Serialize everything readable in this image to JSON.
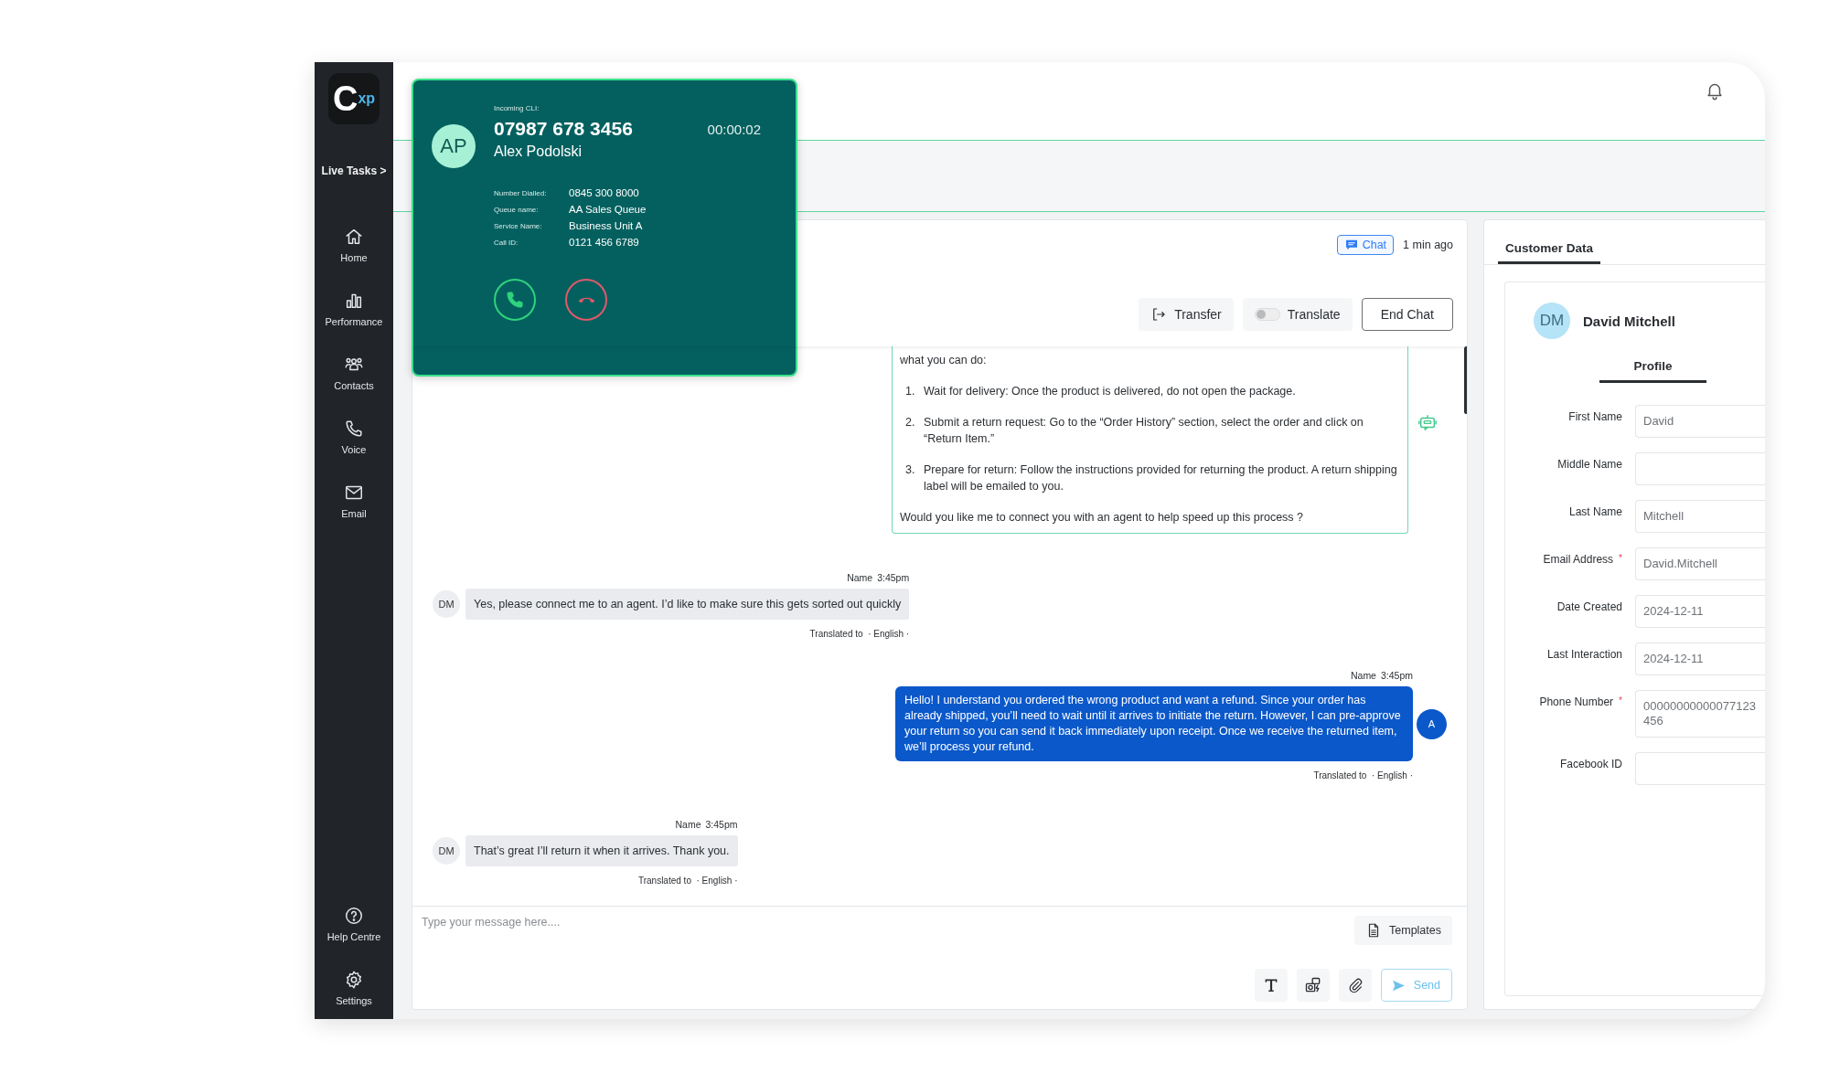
{
  "sidebar": {
    "logo": "C$^{xp}$",
    "live_tasks": "Live Tasks >",
    "items": [
      {
        "label": "Home"
      },
      {
        "label": "Performance"
      },
      {
        "label": "Contacts"
      },
      {
        "label": "Voice"
      },
      {
        "label": "Email"
      }
    ],
    "footer_items": [
      {
        "label": "Help Centre"
      },
      {
        "label": "Settings"
      }
    ]
  },
  "call": {
    "caption": "Incoming CLI:",
    "initials": "AP",
    "number": "07987 678 3456",
    "name": "Alex Podolski",
    "timer": "00:00:02",
    "details": [
      {
        "label": "Number Dialled:",
        "value": "0845 300 8000"
      },
      {
        "label": "Queue name:",
        "value": "AA Sales Queue"
      },
      {
        "label": "Service Name:",
        "value": "Business Unit A"
      },
      {
        "label": "Call ID:",
        "value": "0121 456 6789"
      }
    ]
  },
  "chat": {
    "channel": "Chat",
    "time": "1 min ago",
    "actions": [
      {
        "kind": "transfer",
        "label": "Transfer"
      },
      {
        "kind": "toggle",
        "label": "Translate",
        "on": false
      },
      {
        "kind": "outline",
        "label": "End Chat"
      }
    ],
    "messages": [
      {
        "kind": "bot",
        "intro": "what you can do:",
        "steps": [
          {
            "number": "1.",
            "text": "Wait for delivery: Once the product is delivered, do not open the package."
          },
          {
            "number": "2.",
            "text": "Submit a return request: Go to the “Order History” section, select the order and click on “Return Item.”"
          },
          {
            "number": "3.",
            "text": "Prepare for return: Follow the instructions provided for returning the product. A return shipping label will be emailed to you."
          }
        ],
        "outro": "Would you like me to connect you with an agent to help speed up this process ?"
      },
      {
        "kind": "customer",
        "sender": "Name",
        "time": "3:45pm",
        "initials": "DM",
        "text": "Yes, please connect me to an agent. I’d like to make sure this gets sorted out quickly",
        "translation": "Translated to  · English ·"
      },
      {
        "kind": "agent",
        "sender": "Name",
        "time": "3:45pm",
        "initials": "A",
        "text": "Hello! I understand you ordered the wrong product and want a refund. Since your order has already shipped, you’ll need to wait until it arrives to initiate the return. However, I can pre-approve your return so you can send it back immediately upon receipt. Once we receive the returned item, we’ll process your refund.",
        "translation": "Translated to  · English ·"
      },
      {
        "kind": "customer",
        "sender": "Name",
        "time": "3:45pm",
        "initials": "DM",
        "text": "That’s great I’ll return it when it arrives. Thank you.",
        "translation": "Translated to  · English ·"
      }
    ],
    "composer": {
      "placeholder": "Type your message here....",
      "templates": "Templates",
      "send": {
        "label": "Send",
        "disabled": true
      }
    }
  },
  "customer": {
    "tab": {
      "label": "Customer Data",
      "selected": true
    },
    "initials": "DM",
    "name": "David Mitchell",
    "profile_tab": {
      "label": "Profile",
      "selected": true
    },
    "fields": [
      {
        "label": "First Name",
        "value": "David"
      },
      {
        "label": "Middle Name"
      },
      {
        "label": "Last Name",
        "value": "Mitchell"
      },
      {
        "label": "Email Address",
        "mark": "*",
        "value": "David.Mitchell"
      },
      {
        "label": "Date Created",
        "value": "2024-12-11"
      },
      {
        "label": "Last Interaction",
        "value": "2024-12-11"
      },
      {
        "label": "Phone Number",
        "mark": "*",
        "value": "00000000000077123456"
      },
      {
        "label": "Facebook ID"
      }
    ]
  }
}
